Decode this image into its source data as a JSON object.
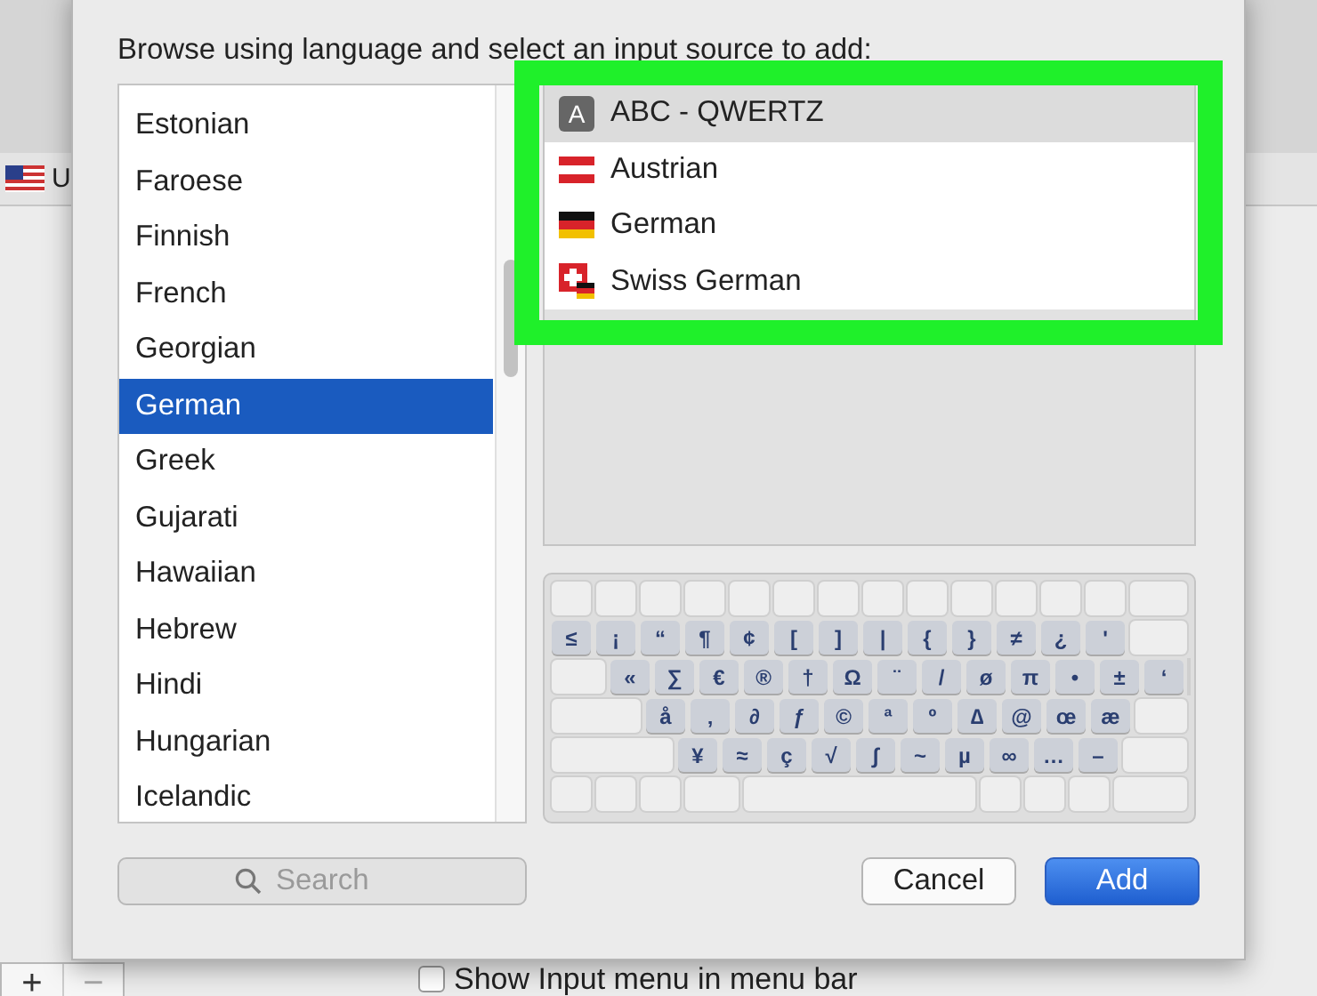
{
  "background_window": {
    "list_item": "U",
    "add_button": "+",
    "remove_button": "−",
    "show_menu_checkbox": {
      "label": "Show Input menu in menu bar",
      "checked": false
    }
  },
  "dialog": {
    "prompt": "Browse using language and select an input source to add:",
    "languages": [
      {
        "label": "Estonian",
        "selected": false
      },
      {
        "label": "Faroese",
        "selected": false
      },
      {
        "label": "Finnish",
        "selected": false
      },
      {
        "label": "French",
        "selected": false
      },
      {
        "label": "Georgian",
        "selected": false
      },
      {
        "label": "German",
        "selected": true
      },
      {
        "label": "Greek",
        "selected": false
      },
      {
        "label": "Gujarati",
        "selected": false
      },
      {
        "label": "Hawaiian",
        "selected": false
      },
      {
        "label": "Hebrew",
        "selected": false
      },
      {
        "label": "Hindi",
        "selected": false
      },
      {
        "label": "Hungarian",
        "selected": false
      },
      {
        "label": "Icelandic",
        "selected": false
      }
    ],
    "input_sources": [
      {
        "label": "ABC - QWERTZ",
        "kind": "abc",
        "icon_letter": "A",
        "selected": true
      },
      {
        "label": "Austrian",
        "kind": "austria",
        "selected": false
      },
      {
        "label": "German",
        "kind": "germany",
        "selected": false
      },
      {
        "label": "Swiss German",
        "kind": "swiss",
        "selected": false
      }
    ],
    "keyboard_rows": [
      [
        "≤",
        "¡",
        "“",
        "¶",
        "¢",
        "[",
        "]",
        "|",
        "{",
        "}",
        "≠",
        "¿",
        "'"
      ],
      [
        "«",
        "∑",
        "€",
        "®",
        "†",
        "Ω",
        "¨",
        "/",
        "ø",
        "π",
        "•",
        "±",
        "‘"
      ],
      [
        "å",
        "‚",
        "∂",
        "ƒ",
        "©",
        "ª",
        "º",
        "∆",
        "@",
        "œ",
        "æ"
      ],
      [
        "¥",
        "≈",
        "ç",
        "√",
        "∫",
        "~",
        "µ",
        "∞",
        "…",
        "–"
      ]
    ],
    "search": {
      "placeholder": "Search"
    },
    "buttons": [
      {
        "label": "Cancel",
        "kind": "default"
      },
      {
        "label": "Add",
        "kind": "primary"
      }
    ]
  }
}
